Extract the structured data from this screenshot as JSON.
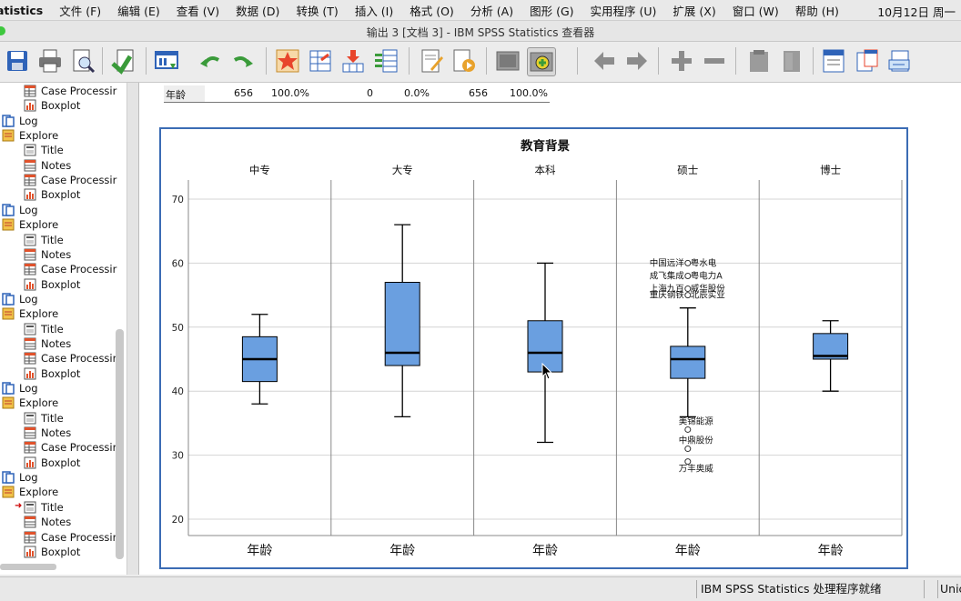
{
  "menubar": {
    "app_name": "atistics",
    "items": [
      "文件 (F)",
      "编辑 (E)",
      "查看 (V)",
      "数据 (D)",
      "转换 (T)",
      "插入 (I)",
      "格式 (O)",
      "分析 (A)",
      "图形 (G)",
      "实用程序 (U)",
      "扩展 (X)",
      "窗口 (W)",
      "帮助 (H)"
    ],
    "clock": "10月12日 周一"
  },
  "window": {
    "title": "输出 3 [文档 3] - IBM SPSS Statistics 查看器"
  },
  "toolbar": {
    "icons": [
      "save-icon",
      "print-icon",
      "print-preview-icon",
      "export-icon",
      "recall-dialog-icon",
      "undo-icon",
      "redo-icon",
      "goto-data-icon",
      "goto-case-icon",
      "goto-variable-icon",
      "variables-icon",
      "create-title-icon",
      "create-annotation-icon",
      "show-all-icon",
      "focus-icon",
      "back-icon",
      "forward-icon",
      "expand-icon",
      "collapse-icon",
      "show-icon",
      "hide-icon",
      "insert-heading-icon",
      "insert-title-icon",
      "insert-text-icon"
    ]
  },
  "tree": {
    "nodes": [
      {
        "label": "Case Processir",
        "kind": "table",
        "level": 2
      },
      {
        "label": "Boxplot",
        "kind": "chart",
        "level": 2
      },
      {
        "label": "Log",
        "kind": "log",
        "level": 0
      },
      {
        "label": "Explore",
        "kind": "explore",
        "level": 0
      },
      {
        "label": "Title",
        "kind": "title",
        "level": 2
      },
      {
        "label": "Notes",
        "kind": "notes",
        "level": 2
      },
      {
        "label": "Case Processir",
        "kind": "table",
        "level": 2
      },
      {
        "label": "Boxplot",
        "kind": "chart",
        "level": 2
      },
      {
        "label": "Log",
        "kind": "log",
        "level": 0
      },
      {
        "label": "Explore",
        "kind": "explore",
        "level": 0
      },
      {
        "label": "Title",
        "kind": "title",
        "level": 2
      },
      {
        "label": "Notes",
        "kind": "notes",
        "level": 2
      },
      {
        "label": "Case Processir",
        "kind": "table",
        "level": 2
      },
      {
        "label": "Boxplot",
        "kind": "chart",
        "level": 2
      },
      {
        "label": "Log",
        "kind": "log",
        "level": 0
      },
      {
        "label": "Explore",
        "kind": "explore",
        "level": 0
      },
      {
        "label": "Title",
        "kind": "title",
        "level": 2
      },
      {
        "label": "Notes",
        "kind": "notes",
        "level": 2
      },
      {
        "label": "Case Processir",
        "kind": "table",
        "level": 2
      },
      {
        "label": "Boxplot",
        "kind": "chart",
        "level": 2
      },
      {
        "label": "Log",
        "kind": "log",
        "level": 0
      },
      {
        "label": "Explore",
        "kind": "explore",
        "level": 0
      },
      {
        "label": "Title",
        "kind": "title",
        "level": 2
      },
      {
        "label": "Notes",
        "kind": "notes",
        "level": 2
      },
      {
        "label": "Case Processir",
        "kind": "table",
        "level": 2
      },
      {
        "label": "Boxplot",
        "kind": "chart",
        "level": 2
      },
      {
        "label": "Log",
        "kind": "log",
        "level": 0
      },
      {
        "label": "Explore",
        "kind": "explore",
        "level": 0
      },
      {
        "label": "Title",
        "kind": "title",
        "level": 2,
        "selected": true
      },
      {
        "label": "Notes",
        "kind": "notes",
        "level": 2
      },
      {
        "label": "Case Processir",
        "kind": "table",
        "level": 2
      },
      {
        "label": "Boxplot",
        "kind": "chart",
        "level": 2
      }
    ]
  },
  "case_table": {
    "label": "年龄",
    "cells": [
      "656",
      "100.0%",
      "0",
      "0.0%",
      "656",
      "100.0%"
    ]
  },
  "chart_data": {
    "type": "boxplot",
    "title": "教育背景",
    "panel_var": "年龄",
    "ylim": [
      17,
      75
    ],
    "yticks": [
      20,
      30,
      40,
      50,
      60,
      70
    ],
    "grid": true,
    "box_color": "#6a9fe0",
    "panels": [
      {
        "name": "中专",
        "min": 38,
        "q1": 41.5,
        "median": 45,
        "q3": 48.5,
        "max": 52,
        "outliers": []
      },
      {
        "name": "大专",
        "min": 36,
        "q1": 44,
        "median": 46,
        "q3": 57,
        "max": 66,
        "outliers": []
      },
      {
        "name": "本科",
        "min": 32,
        "q1": 43,
        "median": 46,
        "q3": 51,
        "max": 60,
        "outliers": []
      },
      {
        "name": "硕士",
        "min": 36,
        "q1": 42,
        "median": 45,
        "q3": 47,
        "max": 53,
        "outliers": [
          {
            "y": 60,
            "labels": [
              "中国远洋",
              "粤水电"
            ]
          },
          {
            "y": 58,
            "labels": [
              "成飞集成",
              "粤电力A"
            ]
          },
          {
            "y": 56,
            "labels": [
              "上海九百",
              "威华股份"
            ]
          },
          {
            "y": 55,
            "labels": [
              "重庆钢铁",
              "北辰实业"
            ]
          },
          {
            "y": 34,
            "labels": [
              "",
              "美锦能源"
            ]
          },
          {
            "y": 31,
            "labels": [
              "",
              "中鼎股份"
            ]
          },
          {
            "y": 29,
            "labels": [
              "",
              "万丰奥威"
            ]
          }
        ]
      },
      {
        "name": "博士",
        "min": 40,
        "q1": 45,
        "median": 45.5,
        "q3": 49,
        "max": 51,
        "outliers": []
      }
    ]
  },
  "statusbar": {
    "status": "IBM SPSS Statistics 处理程序就绪",
    "extra": "Unic"
  }
}
